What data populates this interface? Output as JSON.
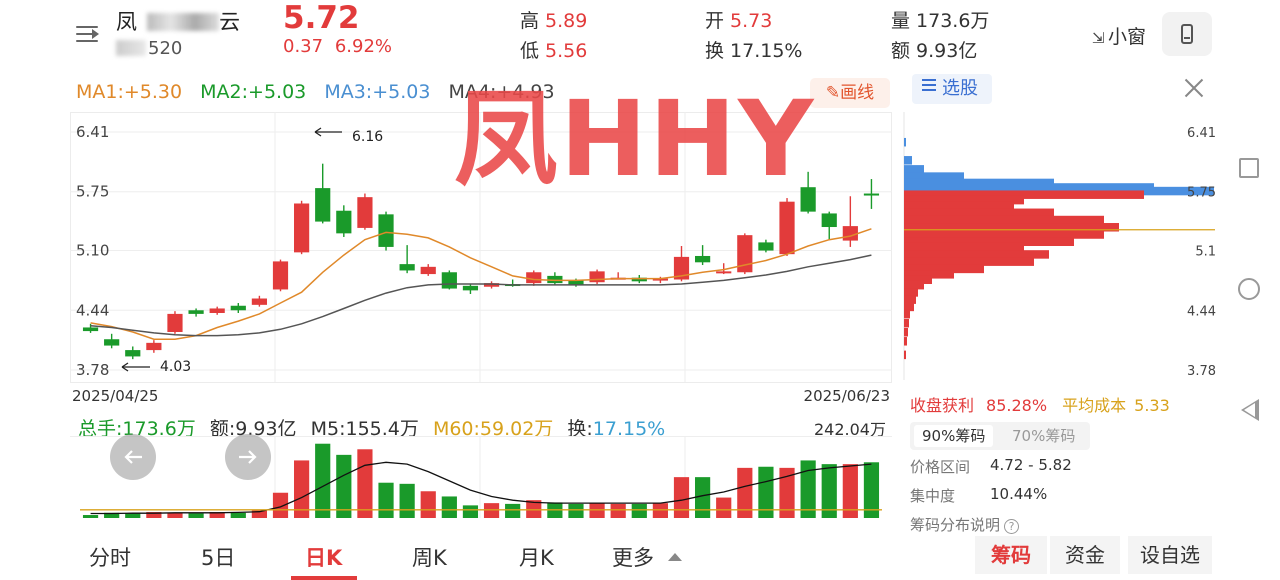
{
  "header": {
    "stock_name_visible": "凤",
    "stock_name_suffix": "云",
    "stock_code_visible": "520",
    "price": "5.72",
    "change": "0.37",
    "change_pct": "6.92%",
    "high_label": "高",
    "high": "5.89",
    "low_label": "低",
    "low": "5.56",
    "open_label": "开",
    "open": "5.73",
    "turnover_label": "换",
    "turnover": "17.15%",
    "volume_label": "量",
    "volume": "173.6万",
    "amount_label": "额",
    "amount": "9.93亿",
    "mini_window": "小窗",
    "menu_icon": "menu-back-icon",
    "phone_icon": "phone-icon"
  },
  "ma_line": {
    "ma1": "MA1:+5.30",
    "ma2": "MA2:+5.03",
    "ma3": "MA3:+5.03",
    "ma4": "MA4:+4.93"
  },
  "draw_button": "✎画线",
  "watermark": "凤HHY",
  "colors": {
    "up": "#e23b3b",
    "down": "#1a9a2a",
    "ma5": "#e0892a",
    "ma_long": "#555555",
    "chip_blue": "#4a8fe0"
  },
  "volume_stats": {
    "total": "总手:173.6万",
    "amount": "额:9.93亿",
    "m5": "M5:155.4万",
    "m60": "M60:59.02万",
    "turnover_label": "换:",
    "turnover": "17.15%",
    "max_label": "242.04万"
  },
  "chart_data": {
    "type": "candlestick",
    "y_ticks": [
      "6.41",
      "5.75",
      "5.10",
      "4.44",
      "3.78"
    ],
    "ylim": [
      3.78,
      6.41
    ],
    "x_start_label": "2025/04/25",
    "x_end_label": "2025/06/23",
    "max_annotation": "6.16",
    "min_annotation": "4.03",
    "candles": [
      {
        "o": 4.25,
        "c": 4.21,
        "h": 4.29,
        "l": 4.19
      },
      {
        "o": 4.12,
        "c": 4.05,
        "h": 4.18,
        "l": 4.02
      },
      {
        "o": 4.0,
        "c": 3.93,
        "h": 4.04,
        "l": 3.9
      },
      {
        "o": 4.0,
        "c": 4.08,
        "h": 4.11,
        "l": 3.97
      },
      {
        "o": 4.2,
        "c": 4.4,
        "h": 4.43,
        "l": 4.18
      },
      {
        "o": 4.44,
        "c": 4.4,
        "h": 4.46,
        "l": 4.37
      },
      {
        "o": 4.41,
        "c": 4.46,
        "h": 4.48,
        "l": 4.39
      },
      {
        "o": 4.49,
        "c": 4.44,
        "h": 4.52,
        "l": 4.41
      },
      {
        "o": 4.5,
        "c": 4.57,
        "h": 4.6,
        "l": 4.48
      },
      {
        "o": 4.67,
        "c": 4.98,
        "h": 5.0,
        "l": 4.65
      },
      {
        "o": 5.08,
        "c": 5.62,
        "h": 5.65,
        "l": 5.06
      },
      {
        "o": 5.79,
        "c": 5.42,
        "h": 6.06,
        "l": 5.4
      },
      {
        "o": 5.54,
        "c": 5.29,
        "h": 5.6,
        "l": 5.25
      },
      {
        "o": 5.35,
        "c": 5.69,
        "h": 5.73,
        "l": 5.33
      },
      {
        "o": 5.5,
        "c": 5.14,
        "h": 5.53,
        "l": 5.1
      },
      {
        "o": 4.95,
        "c": 4.88,
        "h": 5.16,
        "l": 4.85
      },
      {
        "o": 4.84,
        "c": 4.92,
        "h": 4.95,
        "l": 4.82
      },
      {
        "o": 4.86,
        "c": 4.68,
        "h": 4.88,
        "l": 4.67
      },
      {
        "o": 4.71,
        "c": 4.66,
        "h": 4.73,
        "l": 4.62
      },
      {
        "o": 4.7,
        "c": 4.74,
        "h": 4.76,
        "l": 4.68
      },
      {
        "o": 4.73,
        "c": 4.72,
        "h": 4.78,
        "l": 4.7
      },
      {
        "o": 4.74,
        "c": 4.86,
        "h": 4.88,
        "l": 4.71
      },
      {
        "o": 4.82,
        "c": 4.74,
        "h": 4.86,
        "l": 4.72
      },
      {
        "o": 4.77,
        "c": 4.72,
        "h": 4.79,
        "l": 4.7
      },
      {
        "o": 4.75,
        "c": 4.87,
        "h": 4.89,
        "l": 4.73
      },
      {
        "o": 4.8,
        "c": 4.8,
        "h": 4.86,
        "l": 4.78
      },
      {
        "o": 4.8,
        "c": 4.76,
        "h": 4.83,
        "l": 4.74
      },
      {
        "o": 4.77,
        "c": 4.79,
        "h": 4.81,
        "l": 4.74
      },
      {
        "o": 4.78,
        "c": 5.03,
        "h": 5.15,
        "l": 4.76
      },
      {
        "o": 5.04,
        "c": 4.97,
        "h": 5.16,
        "l": 4.94
      },
      {
        "o": 4.87,
        "c": 4.87,
        "h": 4.96,
        "l": 4.84
      },
      {
        "o": 4.86,
        "c": 5.27,
        "h": 5.29,
        "l": 4.84
      },
      {
        "o": 5.19,
        "c": 5.1,
        "h": 5.22,
        "l": 5.08
      },
      {
        "o": 5.06,
        "c": 5.64,
        "h": 5.68,
        "l": 5.04
      },
      {
        "o": 5.8,
        "c": 5.53,
        "h": 5.97,
        "l": 5.51
      },
      {
        "o": 5.51,
        "c": 5.36,
        "h": 5.53,
        "l": 5.22
      },
      {
        "o": 5.21,
        "c": 5.37,
        "h": 5.7,
        "l": 5.14
      },
      {
        "o": 5.73,
        "c": 5.72,
        "h": 5.89,
        "l": 5.56
      }
    ],
    "ma_short": [
      4.3,
      4.26,
      4.2,
      4.12,
      4.12,
      4.16,
      4.25,
      4.32,
      4.4,
      4.52,
      4.64,
      4.86,
      5.05,
      5.22,
      5.3,
      5.28,
      5.24,
      5.14,
      5.02,
      4.92,
      4.82,
      4.78,
      4.77,
      4.77,
      4.78,
      4.79,
      4.79,
      4.79,
      4.82,
      4.86,
      4.89,
      4.94,
      4.99,
      5.06,
      5.15,
      5.22,
      5.26,
      5.34
    ],
    "ma_long": [
      4.27,
      4.25,
      4.22,
      4.19,
      4.17,
      4.16,
      4.16,
      4.17,
      4.19,
      4.23,
      4.29,
      4.37,
      4.46,
      4.55,
      4.63,
      4.69,
      4.72,
      4.73,
      4.73,
      4.73,
      4.72,
      4.72,
      4.72,
      4.72,
      4.72,
      4.72,
      4.72,
      4.72,
      4.73,
      4.75,
      4.77,
      4.8,
      4.83,
      4.87,
      4.92,
      4.96,
      5.0,
      5.05
    ],
    "volume": [
      8,
      14,
      12,
      16,
      14,
      12,
      16,
      14,
      20,
      68,
      155,
      200,
      170,
      185,
      95,
      92,
      72,
      58,
      34,
      40,
      38,
      48,
      42,
      38,
      40,
      38,
      38,
      40,
      110,
      110,
      55,
      135,
      138,
      135,
      155,
      145,
      145,
      150
    ],
    "vol_ma": [
      12,
      12,
      13,
      13,
      14,
      14,
      14,
      15,
      17,
      30,
      55,
      85,
      115,
      142,
      150,
      145,
      125,
      100,
      75,
      58,
      48,
      42,
      40,
      40,
      40,
      40,
      40,
      40,
      48,
      60,
      70,
      85,
      98,
      112,
      128,
      135,
      140,
      145
    ],
    "vol_m60": 22
  },
  "chip_panel": {
    "select_stock": "选股",
    "y_ticks": [
      "6.41",
      "5.75",
      "5.1",
      "4.44",
      "3.78"
    ],
    "profit_label": "收盘获利",
    "profit": "85.28%",
    "avg_cost_label": "平均成本",
    "avg_cost": "5.33",
    "tab_90": "90%筹码",
    "tab_70": "70%筹码",
    "range_label": "价格区间",
    "range": "4.72 - 5.82",
    "concentration_label": "集中度",
    "concentration": "10.44%",
    "explain_label": "筹码分布说明",
    "chips": [
      {
        "p": 6.3,
        "w": 2
      },
      {
        "p": 6.1,
        "w": 8
      },
      {
        "p": 6.0,
        "w": 20
      },
      {
        "p": 5.92,
        "w": 60
      },
      {
        "p": 5.85,
        "w": 150
      },
      {
        "p": 5.8,
        "w": 250
      },
      {
        "p": 5.76,
        "w": 310
      },
      {
        "p": 5.72,
        "w": 240
      },
      {
        "p": 5.66,
        "w": 120
      },
      {
        "p": 5.6,
        "w": 110
      },
      {
        "p": 5.52,
        "w": 150
      },
      {
        "p": 5.44,
        "w": 200
      },
      {
        "p": 5.36,
        "w": 215
      },
      {
        "p": 5.28,
        "w": 200
      },
      {
        "p": 5.2,
        "w": 170
      },
      {
        "p": 5.14,
        "w": 120
      },
      {
        "p": 5.06,
        "w": 145
      },
      {
        "p": 4.98,
        "w": 130
      },
      {
        "p": 4.9,
        "w": 80
      },
      {
        "p": 4.84,
        "w": 50
      },
      {
        "p": 4.78,
        "w": 28
      },
      {
        "p": 4.72,
        "w": 20
      },
      {
        "p": 4.64,
        "w": 14
      },
      {
        "p": 4.56,
        "w": 12
      },
      {
        "p": 4.48,
        "w": 10
      },
      {
        "p": 4.4,
        "w": 6
      },
      {
        "p": 4.3,
        "w": 5
      },
      {
        "p": 4.2,
        "w": 4
      },
      {
        "p": 4.1,
        "w": 3
      },
      {
        "p": 3.95,
        "w": 2
      }
    ]
  },
  "bottom_tabs": [
    "分时",
    "5日",
    "日K",
    "周K",
    "月K",
    "更多"
  ],
  "bottom_buttons": [
    "筹码",
    "资金",
    "设自选"
  ]
}
